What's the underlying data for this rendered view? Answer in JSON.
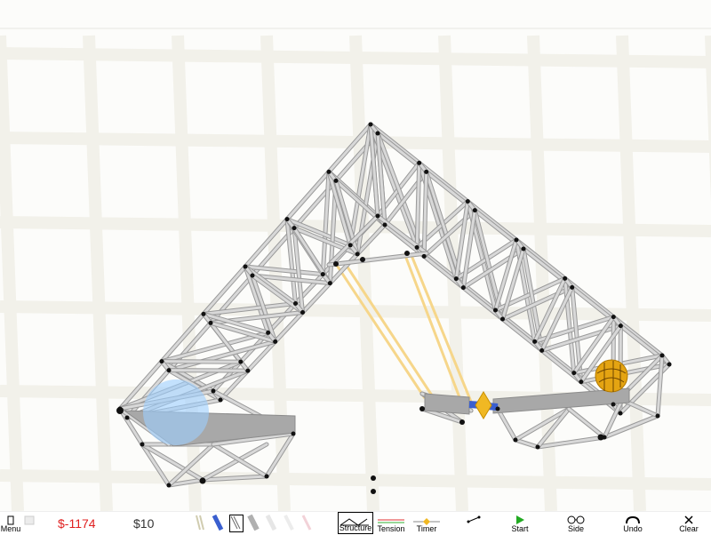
{
  "colors": {
    "background": "#fcfcfa",
    "grid": "#f2f1ea",
    "beam": "#d8d8d8",
    "beam_edge": "#9a9a9a",
    "node": "#111111",
    "road": "#a8a8a8",
    "cable": "#f6d68a",
    "hydraulic": "#3a5fcf",
    "hinge": "#f0b823",
    "ball": "#e4a412",
    "selection": "#9ccfff",
    "cost": "#e02020"
  },
  "toolbar": {
    "menu_label": "Menu",
    "cost": "$-1174",
    "budget": "$10",
    "material_tools": [
      {
        "icon": "wood-beam-icon",
        "color": "#d8d4b8"
      },
      {
        "icon": "hydraulic-icon",
        "color": "#3a5fcf"
      },
      {
        "icon": "steel-beam-icon",
        "color": "#999999"
      },
      {
        "icon": "road-icon",
        "color": "#b8b8b8"
      },
      {
        "icon": "rope-icon",
        "color": "#e8e8e8"
      },
      {
        "icon": "cable-icon",
        "color": "#f0d0d8"
      }
    ],
    "structure_label": "Structure",
    "tension_label": "Tension",
    "timer_label": "Timer",
    "start_label": "Start",
    "side_label": "Side",
    "undo_label": "Undo",
    "clear_label": "Clear"
  }
}
